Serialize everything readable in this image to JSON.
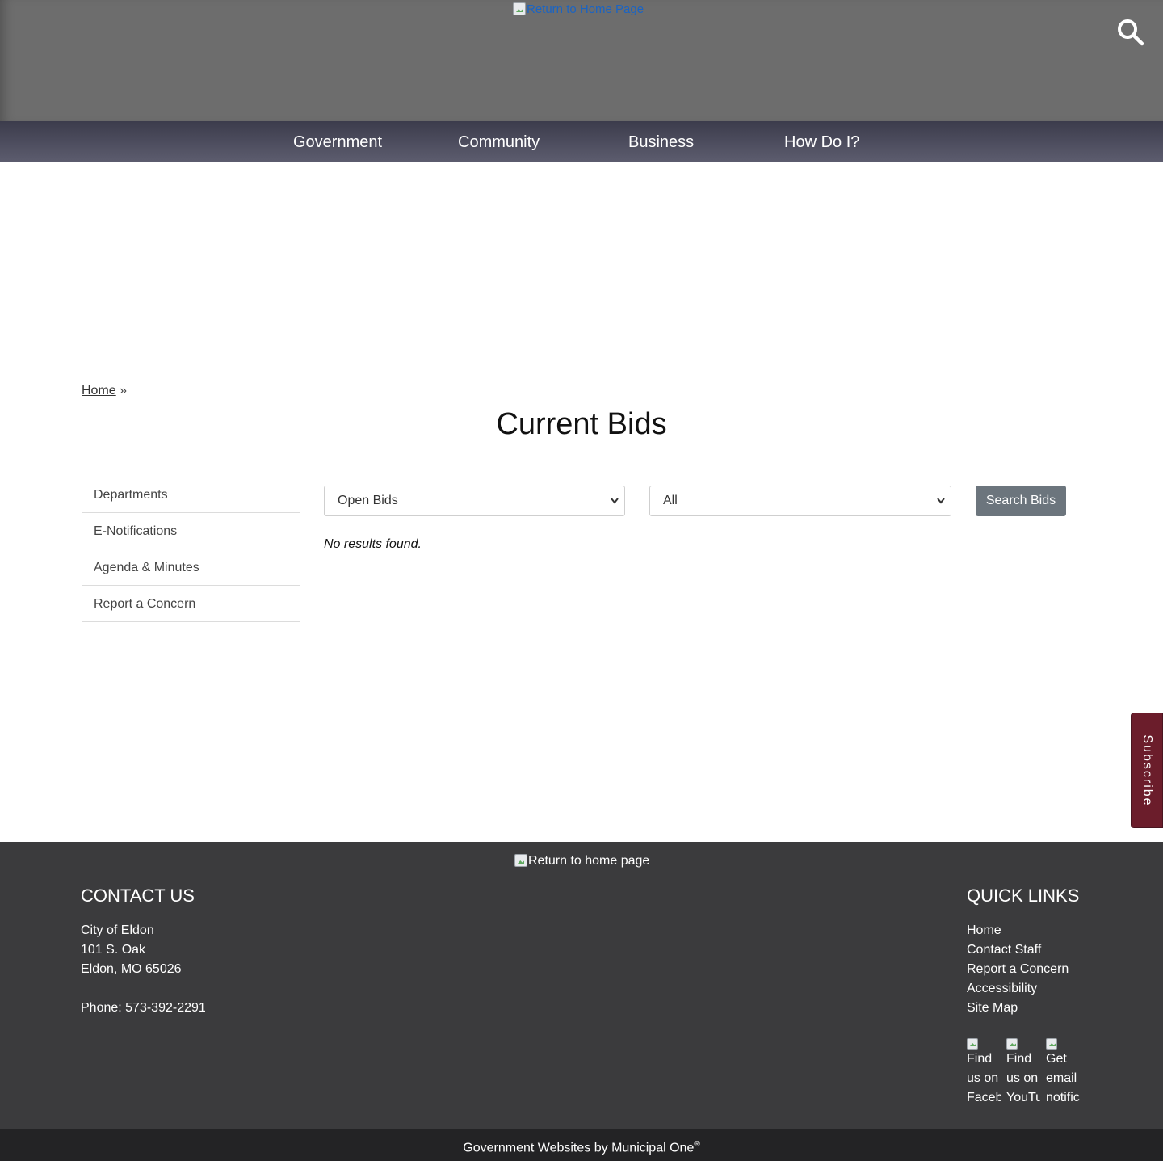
{
  "header": {
    "logo_alt": "Return to Home Page",
    "search_icon": "search-icon"
  },
  "nav": {
    "items": [
      {
        "label": "Government"
      },
      {
        "label": "Community"
      },
      {
        "label": "Business"
      },
      {
        "label": "How Do I?"
      }
    ]
  },
  "breadcrumb": {
    "home": "Home",
    "separator": "»"
  },
  "page": {
    "title": "Current Bids"
  },
  "sidebar": {
    "items": [
      {
        "label": "Departments"
      },
      {
        "label": "E-Notifications"
      },
      {
        "label": "Agenda & Minutes"
      },
      {
        "label": "Report a Concern"
      }
    ]
  },
  "filters": {
    "status_selected": "Open Bids",
    "category_selected": "All",
    "search_label": "Search Bids"
  },
  "results": {
    "empty_message": "No results found."
  },
  "subscribe": {
    "label": "Subscribe",
    "color": "#6b1d2b"
  },
  "footer": {
    "logo_alt": "Return to home page",
    "contact_heading": "CONTACT US",
    "contact": {
      "name": "City of Eldon",
      "street": "101 S. Oak",
      "city": "Eldon, MO 65026",
      "phone": "Phone: 573-392-2291"
    },
    "quick_heading": "QUICK LINKS",
    "quick_links": [
      {
        "label": "Home"
      },
      {
        "label": "Contact Staff"
      },
      {
        "label": "Report a Concern"
      },
      {
        "label": "Accessibility"
      },
      {
        "label": "Site Map"
      }
    ],
    "social": [
      {
        "alt": "Find us on Facebook"
      },
      {
        "alt": "Find us on YouTube"
      },
      {
        "alt": "Get email notifications"
      }
    ]
  },
  "bottom_bar": {
    "text": "Government Websites by Municipal One",
    "mark": "®"
  },
  "colors": {
    "header_bg": "#6d6d6d",
    "nav_bg": "#4a4a5c",
    "footer_bg": "#3b3b3d",
    "bottom_bg": "#232325",
    "button_bg": "#6c757d"
  }
}
